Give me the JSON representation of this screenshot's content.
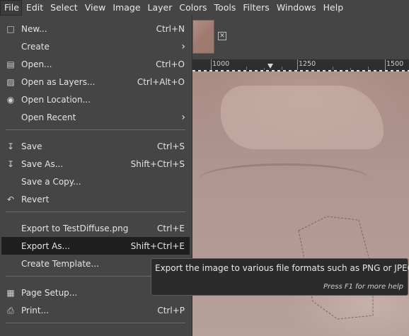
{
  "menubar": {
    "items": [
      {
        "label": "File",
        "active": true
      },
      {
        "label": "Edit"
      },
      {
        "label": "Select"
      },
      {
        "label": "View"
      },
      {
        "label": "Image"
      },
      {
        "label": "Layer"
      },
      {
        "label": "Colors"
      },
      {
        "label": "Tools"
      },
      {
        "label": "Filters"
      },
      {
        "label": "Windows"
      },
      {
        "label": "Help"
      }
    ]
  },
  "file_menu": {
    "items": [
      {
        "label": "New...",
        "accel": "Ctrl+N",
        "icon": "new-document-icon"
      },
      {
        "label": "Create",
        "submenu": true
      },
      {
        "label": "Open...",
        "accel": "Ctrl+O",
        "icon": "open-icon"
      },
      {
        "label": "Open as Layers...",
        "accel": "Ctrl+Alt+O",
        "icon": "open-layers-icon"
      },
      {
        "label": "Open Location...",
        "icon": "location-icon"
      },
      {
        "label": "Open Recent",
        "submenu": true
      },
      {
        "label": "Save",
        "accel": "Ctrl+S",
        "icon": "save-icon"
      },
      {
        "label": "Save As...",
        "accel": "Shift+Ctrl+S",
        "icon": "save-as-icon"
      },
      {
        "label": "Save a Copy..."
      },
      {
        "label": "Revert",
        "icon": "revert-icon"
      },
      {
        "label": "Export to TestDiffuse.png",
        "accel": "Ctrl+E"
      },
      {
        "label": "Export As...",
        "accel": "Shift+Ctrl+E",
        "highlighted": true
      },
      {
        "label": "Create Template..."
      },
      {
        "label": "Page Setup...",
        "icon": "page-setup-icon"
      },
      {
        "label": "Print...",
        "accel": "Ctrl+P",
        "icon": "print-icon"
      }
    ]
  },
  "ruler": {
    "labels": [
      "1000",
      "1250",
      "1500"
    ]
  },
  "tooltip": {
    "text": "Export the image to various file formats such as PNG or JPEG",
    "help": "Press F1 for more help"
  },
  "colors": {
    "menu_bg": "#454545",
    "highlight_bg": "#1f1f1f",
    "tooltip_bg": "#2b2b2b",
    "canvas": "#b09690"
  }
}
